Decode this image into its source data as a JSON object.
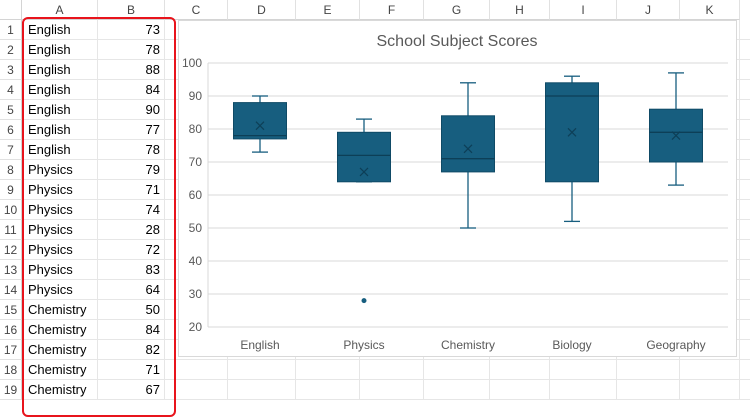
{
  "columns": [
    "A",
    "B",
    "C",
    "D",
    "E",
    "F",
    "G",
    "H",
    "I",
    "J",
    "K"
  ],
  "rows": [
    [
      "English",
      73
    ],
    [
      "English",
      78
    ],
    [
      "English",
      88
    ],
    [
      "English",
      84
    ],
    [
      "English",
      90
    ],
    [
      "English",
      77
    ],
    [
      "English",
      78
    ],
    [
      "Physics",
      79
    ],
    [
      "Physics",
      71
    ],
    [
      "Physics",
      74
    ],
    [
      "Physics",
      28
    ],
    [
      "Physics",
      72
    ],
    [
      "Physics",
      83
    ],
    [
      "Physics",
      64
    ],
    [
      "Chemistry",
      50
    ],
    [
      "Chemistry",
      84
    ],
    [
      "Chemistry",
      82
    ],
    [
      "Chemistry",
      71
    ],
    [
      "Chemistry",
      67
    ]
  ],
  "chart_data": {
    "type": "box",
    "title": "School Subject Scores",
    "categories": [
      "English",
      "Physics",
      "Chemistry",
      "Biology",
      "Geography"
    ],
    "boxes": [
      {
        "min": 73,
        "q1": 77,
        "median": 78,
        "q3": 88,
        "max": 90,
        "mean": 81,
        "outliers": []
      },
      {
        "min": 64,
        "q1": 64,
        "median": 72,
        "q3": 79,
        "max": 83,
        "mean": 67,
        "outliers": [
          28
        ]
      },
      {
        "min": 50,
        "q1": 67,
        "median": 71,
        "q3": 84,
        "max": 94,
        "mean": 74,
        "outliers": []
      },
      {
        "min": 52,
        "q1": 64,
        "median": 90,
        "q3": 94,
        "max": 96,
        "mean": 79,
        "outliers": []
      },
      {
        "min": 63,
        "q1": 70,
        "median": 79,
        "q3": 86,
        "max": 97,
        "mean": 78,
        "outliers": []
      }
    ],
    "yticks": [
      20,
      30,
      40,
      50,
      60,
      70,
      80,
      90,
      100
    ],
    "ylim": [
      20,
      100
    ],
    "grid": true,
    "color": "#175e7f"
  }
}
